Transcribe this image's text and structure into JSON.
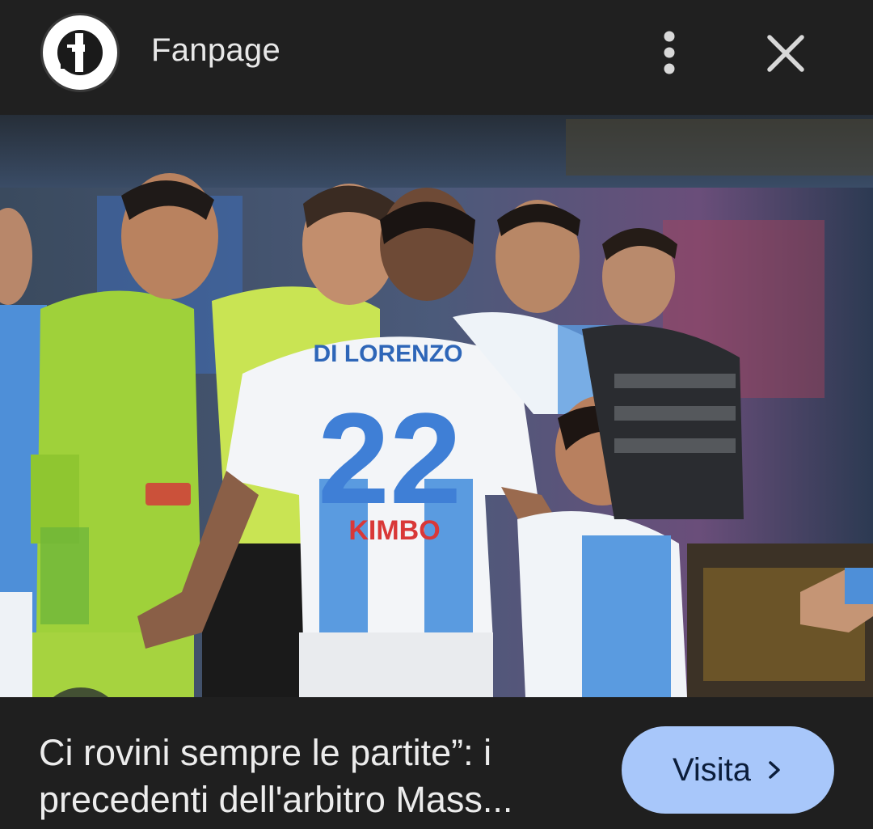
{
  "header": {
    "source_name": "Fanpage",
    "logo_icon": "fanpage-logo-icon",
    "more_icon": "more-vert-icon",
    "close_icon": "close-icon"
  },
  "image": {
    "description_icon": "photo",
    "jersey_name": "DI LORENZO",
    "jersey_number": "22",
    "sponsor": "KIMBO",
    "lens_icon": "lens-search-icon"
  },
  "footer": {
    "caption": "Ci rovini sempre le partite”: i\nprecedenti dell'arbitro Mass...",
    "visit_label": "Visita",
    "visit_icon": "chevron-right-icon"
  },
  "colors": {
    "background": "#1f1f1f",
    "visit_button": "#a8c7fa",
    "text": "#ececec"
  }
}
